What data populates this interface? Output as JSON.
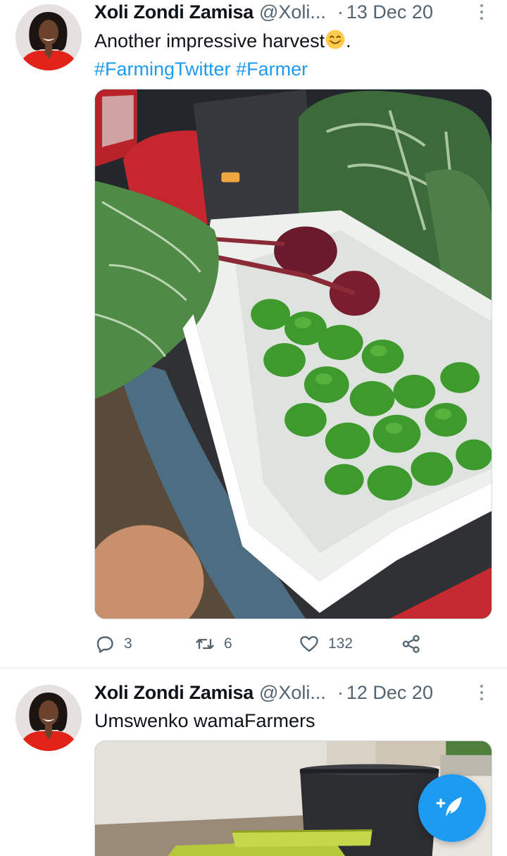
{
  "tweets": [
    {
      "author": "Xoli Zondi Zamisa",
      "handle": "@Xoli...",
      "dot": "·",
      "date": "13 Dec 20",
      "text_before_emoji": "Another impressive harvest",
      "text_after_emoji": ".",
      "emoji": "smiling-face-emoji",
      "hashtags": [
        "#FarmingTwitter",
        "#Farmer"
      ],
      "media": "photo of harvested green peppers, beetroot and spinach in a white crate in a car boot",
      "stats": {
        "replies": "3",
        "retweets": "6",
        "likes": "132"
      }
    },
    {
      "author": "Xoli Zondi Zamisa",
      "handle": "@Xoli...",
      "dot": "·",
      "date": "12 Dec 20",
      "text": "Umswenko wamaFarmers",
      "media": "photo of black water tank and yellow-green tubs beside a wall"
    }
  ],
  "icons": {
    "reply": "reply-icon",
    "retweet": "retweet-icon",
    "like": "heart-icon",
    "share": "share-icon",
    "compose": "compose-tweet-icon"
  },
  "colors": {
    "accent": "#1d9bf0",
    "text": "#0f1419",
    "secondary": "#536471"
  }
}
